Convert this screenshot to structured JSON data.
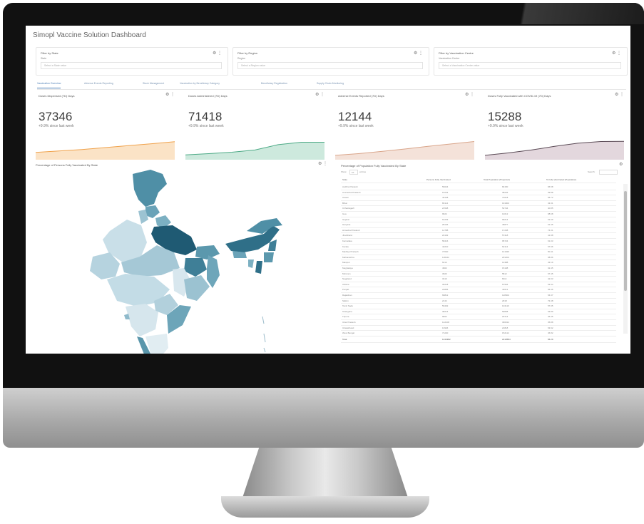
{
  "app": {
    "title": "Simopl Vaccine Solution Dashboard"
  },
  "filters": [
    {
      "title": "Filter by State",
      "sublabel": "State",
      "placeholder": "Select a State value"
    },
    {
      "title": "Filter by Region",
      "sublabel": "Region",
      "placeholder": "Select a Region value"
    },
    {
      "title": "Filter by Vaccination Centre",
      "sublabel": "Vaccination Centre",
      "placeholder": "Select a Vaccination Centre value"
    }
  ],
  "tabs": [
    {
      "label": "Vaccination Overview",
      "active": true
    },
    {
      "label": "Adverse Events Reporting",
      "active": false
    },
    {
      "label": "Stock Management",
      "active": false
    },
    {
      "label": "Vaccination by Beneficiary Category",
      "active": false
    },
    {
      "label": "Beneficiary Registration",
      "active": false
    },
    {
      "label": "Supply Chain Monitoring",
      "active": false
    }
  ],
  "kpis": [
    {
      "title": "Doses Dispensed (7D) Days",
      "value": "37346",
      "change": "+9.9% since last week",
      "color": "#f0a24b",
      "fill": "#fbe3c6",
      "trend": [
        0.3,
        0.36,
        0.42,
        0.5,
        0.58,
        0.66,
        0.74
      ]
    },
    {
      "title": "Doses Administered (7D) Days",
      "value": "71418",
      "change": "+9.9% since last week",
      "color": "#4daa86",
      "fill": "#cde9dd",
      "trend": [
        0.2,
        0.25,
        0.31,
        0.4,
        0.62,
        0.72,
        0.72
      ]
    },
    {
      "title": "Adverse Events Reported (7D) Days",
      "value": "12144",
      "change": "+9.9% since last week",
      "color": "#d9a58a",
      "fill": "#f4e2d9",
      "trend": [
        0.18,
        0.25,
        0.34,
        0.44,
        0.55,
        0.65,
        0.75
      ]
    },
    {
      "title": "Doses Fully Vaccinated with COVID-19 (7D) Days",
      "value": "15288",
      "change": "+9.9% since last week",
      "color": "#5a4a55",
      "fill": "#e3d7dd",
      "trend": [
        0.18,
        0.28,
        0.4,
        0.55,
        0.68,
        0.75,
        0.76
      ]
    }
  ],
  "map": {
    "title": "Percentage of Persons Fully Vaccinated By State"
  },
  "table": {
    "title": "Percentage of Population Fully Vaccinated By State",
    "show_label": "Show",
    "entries_value": "10",
    "entries_label": "entries",
    "search_label": "Search:",
    "columns": [
      "State",
      "Persons Fully Vaccinated",
      "Total Population (Projected)",
      "% Fully Vaccinated (Population)"
    ],
    "rows": [
      [
        "Andhra Pradesh",
        "56024",
        "84150",
        "66.58"
      ],
      [
        "Arunachal Pradesh",
        "15244",
        "38226",
        "39.88"
      ],
      [
        "Assam",
        "40128",
        "72018",
        "55.72"
      ],
      [
        "Bihar",
        "83114",
        "191902",
        "43.31"
      ],
      [
        "Chhattisgarh",
        "21548",
        "52744",
        "40.85"
      ],
      [
        "Goa",
        "9624",
        "14012",
        "68.68"
      ],
      [
        "Gujarat",
        "61203",
        "99214",
        "61.69"
      ],
      [
        "Haryana",
        "28146",
        "45877",
        "61.35"
      ],
      [
        "Himachal Pradesh",
        "12788",
        "17208",
        "74.31"
      ],
      [
        "Jharkhand",
        "24102",
        "57418",
        "41.98"
      ],
      [
        "Karnataka",
        "58416",
        "95724",
        "61.03"
      ],
      [
        "Kerala",
        "42210",
        "62114",
        "67.96"
      ],
      [
        "Madhya Pradesh",
        "71540",
        "141926",
        "50.41"
      ],
      [
        "Maharashtra",
        "118422",
        "201204",
        "58.86"
      ],
      [
        "Manipur",
        "6214",
        "14388",
        "43.19"
      ],
      [
        "Meghalaya",
        "4902",
        "15108",
        "32.45"
      ],
      [
        "Mizoram",
        "3920",
        "5812",
        "67.45"
      ],
      [
        "Nagaland",
        "3410",
        "8114",
        "42.03"
      ],
      [
        "Odisha",
        "36218",
        "67904",
        "53.34"
      ],
      [
        "Punjab",
        "24806",
        "44012",
        "56.36"
      ],
      [
        "Rajasthan",
        "69812",
        "128402",
        "54.37"
      ],
      [
        "Sikkim",
        "2144",
        "2918",
        "73.48"
      ],
      [
        "Tamil Nadu",
        "59402",
        "104116",
        "57.05"
      ],
      [
        "Telangana",
        "38214",
        "59808",
        "63.89"
      ],
      [
        "Tripura",
        "9602",
        "20714",
        "46.35"
      ],
      [
        "Uttar Pradesh",
        "142108",
        "396012",
        "35.88"
      ],
      [
        "Uttarakhand",
        "13946",
        "21818",
        "63.92"
      ],
      [
        "West Bengal",
        "71220",
        "152114",
        "46.82"
      ]
    ],
    "total_row": [
      "Total",
      "1244382",
      "2210584",
      "56.29"
    ]
  },
  "icons": {
    "panel_menu": "gear-icon"
  }
}
